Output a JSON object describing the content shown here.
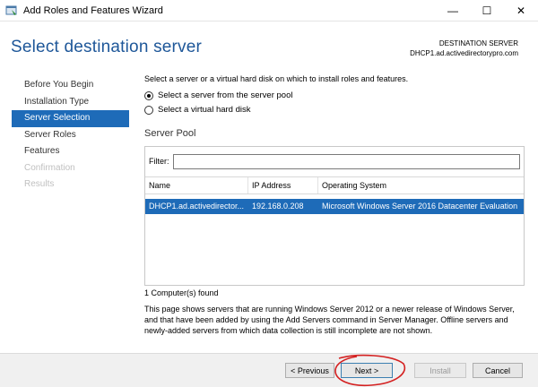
{
  "window": {
    "title": "Add Roles and Features Wizard",
    "minimize_glyph": "—",
    "maximize_glyph": "☐",
    "close_glyph": "✕"
  },
  "header": {
    "page_title": "Select destination server",
    "destination_label": "DESTINATION SERVER",
    "destination_value": "DHCP1.ad.activedirectorypro.com"
  },
  "nav": {
    "items": [
      {
        "label": "Before You Begin",
        "state": "normal"
      },
      {
        "label": "Installation Type",
        "state": "normal"
      },
      {
        "label": "Server Selection",
        "state": "active"
      },
      {
        "label": "Server Roles",
        "state": "normal"
      },
      {
        "label": "Features",
        "state": "normal"
      },
      {
        "label": "Confirmation",
        "state": "disabled"
      },
      {
        "label": "Results",
        "state": "disabled"
      }
    ]
  },
  "main": {
    "intro": "Select a server or a virtual hard disk on which to install roles and features.",
    "options": [
      {
        "label": "Select a server from the server pool",
        "checked": true
      },
      {
        "label": "Select a virtual hard disk",
        "checked": false
      }
    ],
    "pool_title": "Server Pool",
    "filter_label": "Filter:",
    "filter_value": "",
    "columns": [
      "Name",
      "IP Address",
      "Operating System"
    ],
    "rows": [
      {
        "name": "DHCP1.ad.activedirector...",
        "ip": "192.168.0.208",
        "os": "Microsoft Windows Server 2016 Datacenter Evaluation"
      }
    ],
    "found_text": "1 Computer(s) found",
    "description": "This page shows servers that are running Windows Server 2012 or a newer release of Windows Server, and that have been added by using the Add Servers command in Server Manager. Offline servers and newly-added servers from which data collection is still incomplete are not shown."
  },
  "footer": {
    "previous_label": "< Previous",
    "next_label": "Next >",
    "install_label": "Install",
    "cancel_label": "Cancel"
  },
  "colors": {
    "accent": "#1e6bb8",
    "title_blue": "#1e5799",
    "annotation_red": "#d42020"
  }
}
